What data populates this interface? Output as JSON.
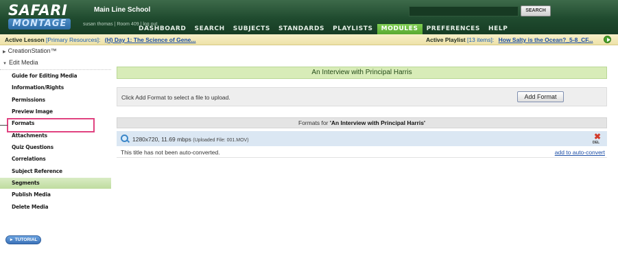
{
  "header": {
    "logo_top": "SAFARI",
    "logo_bottom": "MONTAGE",
    "school_name": "Main Line School",
    "user": "susan thomas",
    "room": "Room 409",
    "logout": "log out",
    "search_value": "",
    "search_button": "SEARCH"
  },
  "nav": {
    "items": [
      "DASHBOARD",
      "SEARCH",
      "SUBJECTS",
      "STANDARDS",
      "PLAYLISTS",
      "MODULES",
      "PREFERENCES",
      "HELP"
    ],
    "active": "MODULES"
  },
  "active_bar": {
    "lesson_label": "Active Lesson",
    "lesson_bracket": "[Primary Resources]:",
    "lesson_link": "(H) Day 1: The Science of Gene...",
    "playlist_label": "Active Playlist",
    "playlist_bracket": "[13 items]:",
    "playlist_link": "How Salty is the Ocean?_5-8_CF..."
  },
  "sidebar": {
    "creation_station": "CreationStation™",
    "edit_media": "Edit Media",
    "items": [
      "Guide for Editing Media",
      "Information/Rights",
      "Permissions",
      "Preview Image",
      "Formats",
      "Attachments",
      "Quiz Questions",
      "Correlations",
      "Subject Reference",
      "Segments",
      "Publish Media",
      "Delete Media"
    ],
    "selected": "Formats",
    "highlighted": "Preview Image",
    "tutorial": "► TUTORIAL"
  },
  "main": {
    "title": "An Interview with Principal Harris",
    "upload_text": "Click Add Format to select a file to upload.",
    "add_format_button": "Add Format",
    "formats_header_prefix": "Formats for ",
    "formats_header_title": "'An Interview with Principal Harris'",
    "format_row": {
      "spec": "1280x720, 11.69 mbps",
      "uploaded": "(Uploaded File: 001.MOV)",
      "del_label": "DEL"
    },
    "convert_text": "This title has not been auto-converted.",
    "auto_convert_link": "add to auto-convert"
  },
  "colors": {
    "header_green": "#1f4a2e",
    "nav_active": "#58a831",
    "title_bar": "#d8ecb8",
    "highlight_pink": "#e0417f",
    "link_blue": "#1c4ea6"
  }
}
